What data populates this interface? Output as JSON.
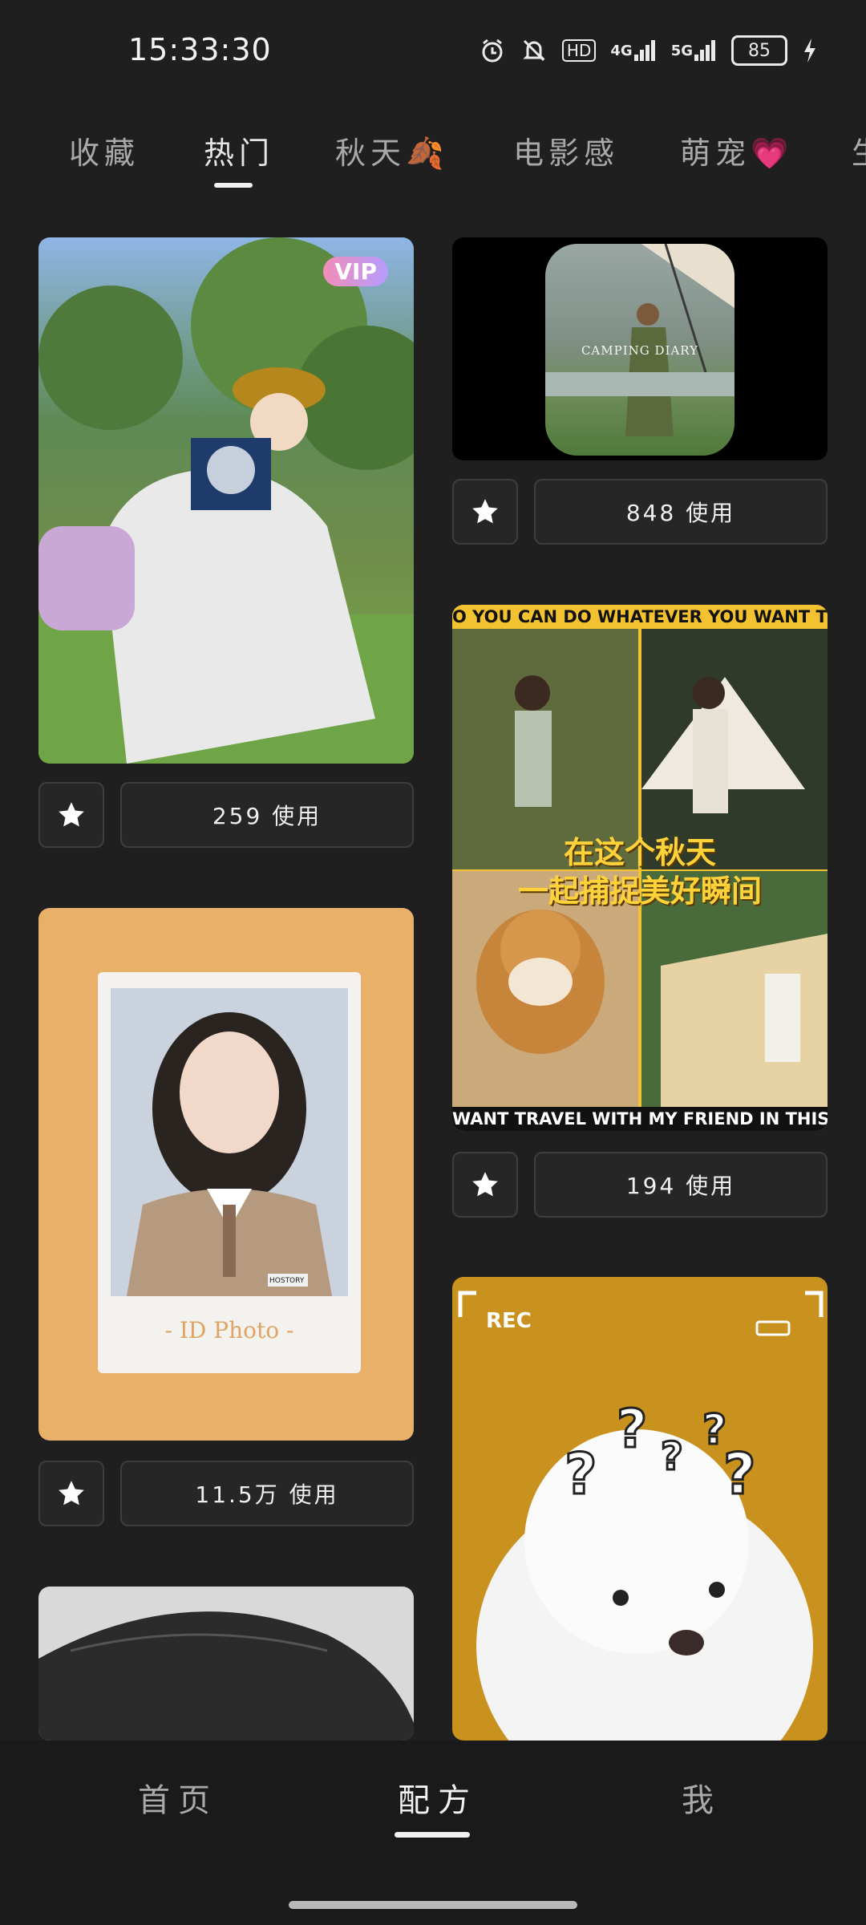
{
  "status_bar": {
    "time": "15:33:30",
    "hd_label": "HD",
    "net1_label": "4G",
    "net2_label": "5G",
    "battery_level": "85"
  },
  "tabs": [
    {
      "label": "收藏"
    },
    {
      "label": "热门"
    },
    {
      "label": "秋天🍂"
    },
    {
      "label": "电影感"
    },
    {
      "label": "萌宠💗"
    },
    {
      "label": "生"
    }
  ],
  "active_tab": "热门",
  "cards": [
    {
      "badge": "VIP",
      "uses": "259 使用"
    },
    {
      "overlay": "CAMPING DIARY",
      "uses": "848 使用"
    },
    {
      "top_banner": "O YOU CAN DO WHATEVER YOU WANT TO",
      "caption_1": "在这个秋天",
      "caption_2": "一起捕捉美好瞬间",
      "bottom_banner": "WANT TRAVEL WITH MY FRIEND IN THIS",
      "uses": "194 使用"
    },
    {
      "overlay": "- ID Photo -",
      "stamp": "HOSTORY",
      "uses": "11.5万 使用"
    },
    {
      "overlay": "REC"
    },
    {}
  ],
  "bottom_nav": [
    {
      "label": "首页"
    },
    {
      "label": "配方"
    },
    {
      "label": "我"
    }
  ],
  "active_nav": "配方",
  "colors": {
    "background": "#1f1f1f",
    "card_border": "#3e3e3e",
    "vip_gradient": "#f38db7"
  }
}
